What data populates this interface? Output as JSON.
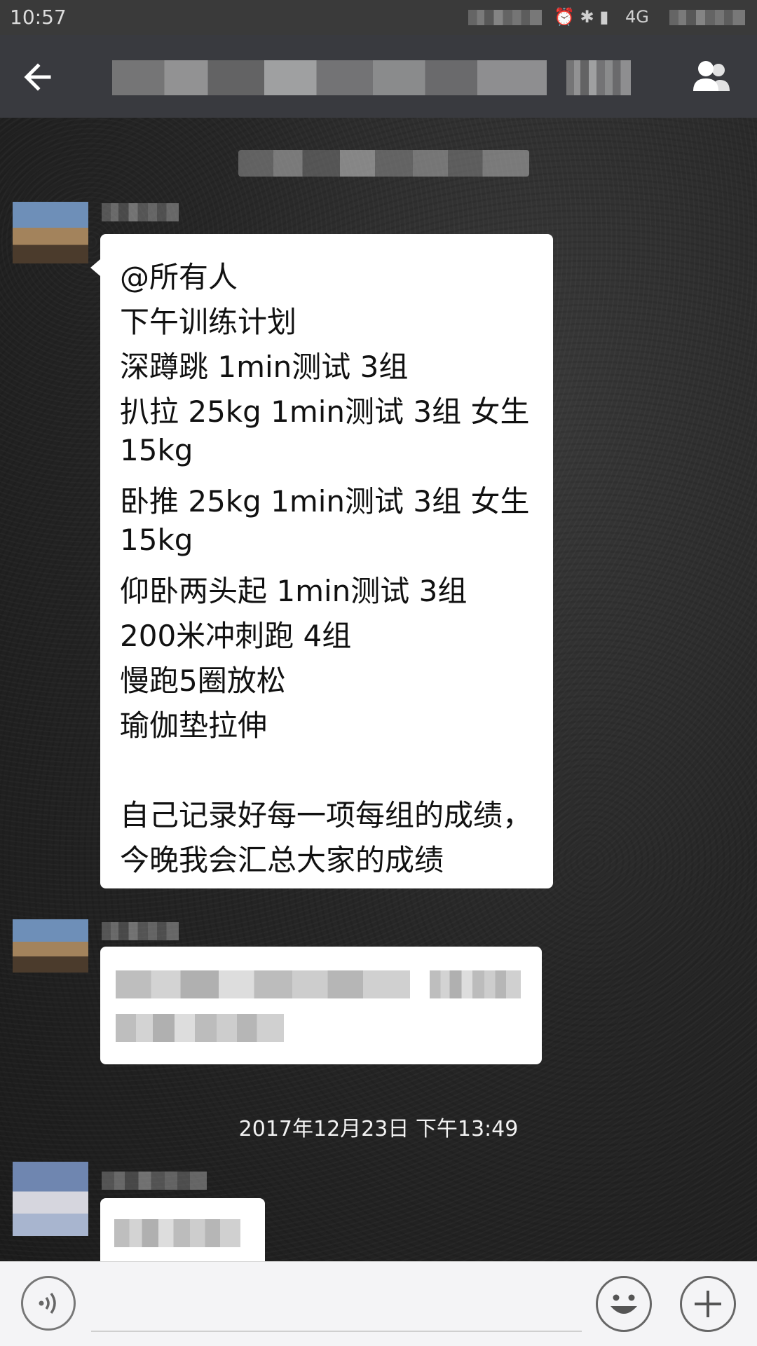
{
  "status_bar": {
    "time": "10:57",
    "network": "4G"
  },
  "header": {
    "back_icon": "arrow-left-icon",
    "group_icon": "group-members-icon"
  },
  "messages": {
    "announcement_lines": [
      "@所有人",
      "下午训练计划",
      "深蹲跳 1min测试 3组",
      "扒拉 25kg 1min测试 3组 女生",
      "15kg",
      "卧推 25kg 1min测试 3组 女生",
      "15kg",
      "仰卧两头起 1min测试 3组",
      "200米冲刺跑 4组",
      "慢跑5圈放松",
      "瑜伽垫拉伸",
      "",
      "自己记录好每一项每组的成绩，",
      "今晚我会汇总大家的成绩"
    ]
  },
  "timestamp": "2017年12月23日 下午13:49",
  "input_bar": {
    "voice_icon": "voice-icon",
    "emoji_icon": "emoji-icon",
    "plus_icon": "plus-icon"
  }
}
